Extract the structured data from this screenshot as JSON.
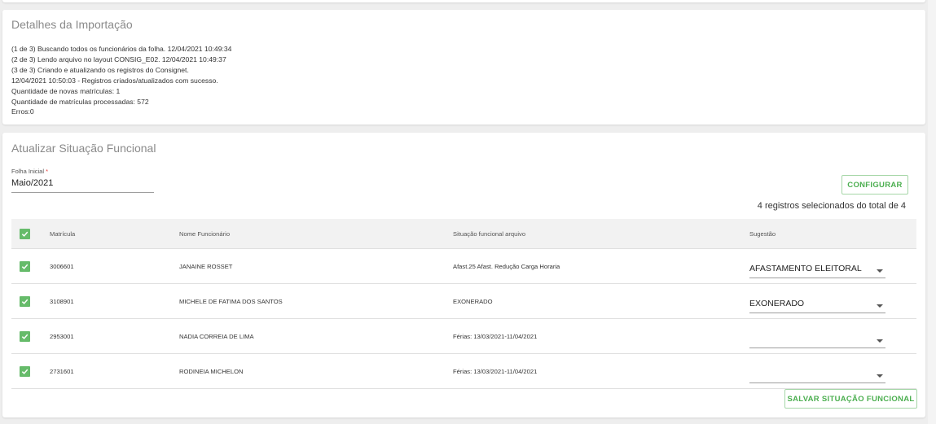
{
  "details": {
    "title": "Detalhes da Importação",
    "log": [
      "(1 de 3) Buscando todos os funcionários da folha. 12/04/2021 10:49:34",
      "(2 de 3) Lendo arquivo no layout CONSIG_E02. 12/04/2021 10:49:37",
      "(3 de 3) Criando e atualizando os registros do Consignet.",
      "12/04/2021 10:50:03 - Registros criados/atualizados com sucesso.",
      "Quantidade de novas matrículas: 1",
      "Quantidade de matrículas processadas: 572",
      "Erros:0"
    ]
  },
  "situacao": {
    "title": "Atualizar Situação Funcional",
    "folha_label": "Folha Inicial",
    "required_mark": "*",
    "folha_value": "Maio/2021",
    "configurar_label": "CONFIGURAR",
    "count_text": "4 registros selecionados do total de 4",
    "save_label": "SALVAR SITUAÇÃO FUNCIONAL",
    "checkbox_color": "#66bb6a",
    "accent_color": "#4caf50",
    "columns": {
      "matricula": "Matrícula",
      "nome": "Nome Funcionário",
      "situacao": "Situação funcional arquivo",
      "sugestao": "Sugestão"
    },
    "rows": [
      {
        "matricula": "3006601",
        "nome": "JANAINE ROSSET",
        "situacao": "Afast.25 Afast. Redução Carga Horaria",
        "sugestao": "AFASTAMENTO ELEITORAL",
        "checked": true
      },
      {
        "matricula": "3108901",
        "nome": "MICHELE DE FATIMA DOS SANTOS",
        "situacao": "EXONERADO",
        "sugestao": "EXONERADO",
        "checked": true
      },
      {
        "matricula": "2953001",
        "nome": "NADIA CORREIA DE LIMA",
        "situacao": "Férias: 13/03/2021-11/04/2021",
        "sugestao": "",
        "checked": true
      },
      {
        "matricula": "2731601",
        "nome": "RODINEIA MICHELON",
        "situacao": "Férias: 13/03/2021-11/04/2021",
        "sugestao": "",
        "checked": true
      }
    ]
  }
}
